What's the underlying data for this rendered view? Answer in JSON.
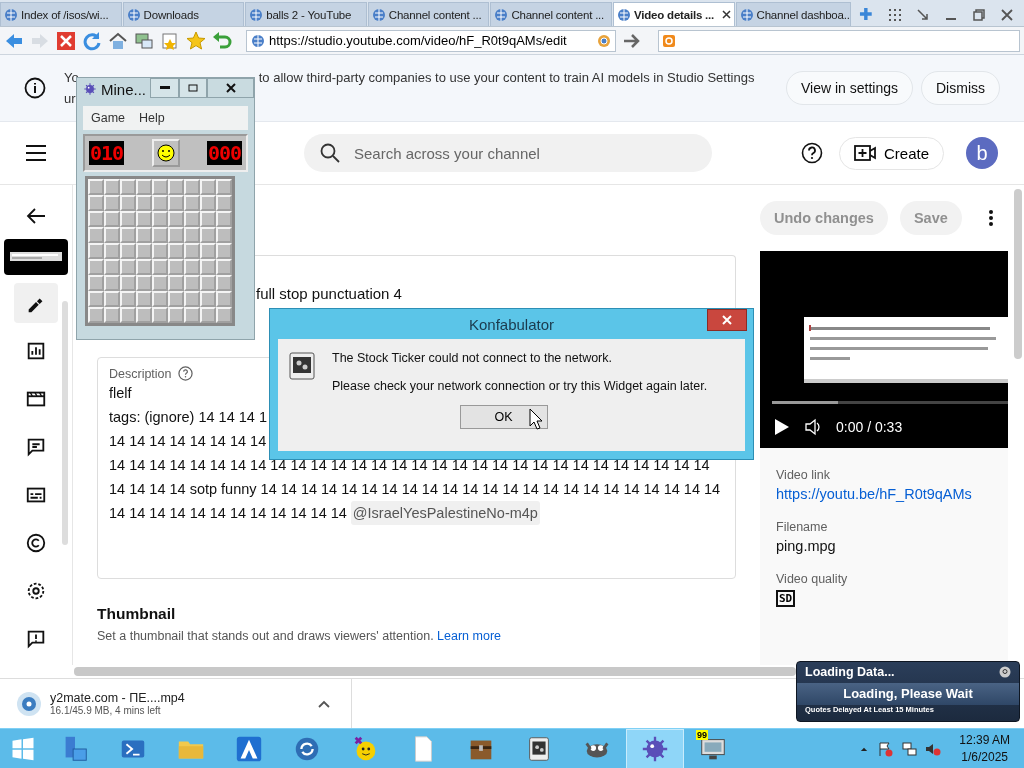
{
  "browser": {
    "tabs": [
      {
        "title": "Index of /isos/wi...",
        "selected": false
      },
      {
        "title": "Downloads",
        "selected": false
      },
      {
        "title": "balls 2 - YouTube",
        "selected": false
      },
      {
        "title": "Channel content ...",
        "selected": false
      },
      {
        "title": "Channel content ...",
        "selected": false
      },
      {
        "title": "Video details ...",
        "selected": true
      },
      {
        "title": "Channel dashboa...",
        "selected": false
      }
    ],
    "url": "https://studio.youtube.com/video/hF_R0t9qAMs/edit"
  },
  "banner": {
    "text_parts": [
      "Yo",
      "to allow third-party companies to use your content to train AI models in Studio Settings",
      "ur"
    ],
    "buttons": [
      "View in settings",
      "Dismiss"
    ]
  },
  "header": {
    "search_placeholder": "Search across your channel",
    "create": "Create",
    "avatar": "b"
  },
  "sidebar": {
    "items": [
      {
        "selected": true
      },
      {
        "selected": false
      },
      {
        "selected": false
      },
      {
        "selected": false
      },
      {
        "selected": false
      },
      {
        "selected": false
      },
      {
        "selected": false
      },
      {
        "selected": false
      }
    ]
  },
  "editor": {
    "title_value": "full stop punctuation 4",
    "description": {
      "label": "Description",
      "lines": [
        "flelf",
        "tags: (ignore) 14 14 14 1",
        "14 14 14 14 14 14 14 14",
        "14 14 14 14 14 14 14 14 14 14 14 14 14 14 14 14 14 14 14 14 14 14 14 14 14 14 14 14 14 14",
        "14 14 14 14  sotp funny 14 14 14 14 14 14 14 14 14 14 14 14 14 14 14 14 14 14 14 14 14 14 14",
        "14 14 14 14 14 14 14 14 14 14 14 14"
      ],
      "mention": "@IsraelYesPalestineNo-m4p"
    },
    "thumbnail": {
      "heading": "Thumbnail",
      "text": "Set a thumbnail that stands out and draws viewers' attention.",
      "link": "Learn more"
    }
  },
  "actions": {
    "undo": "Undo changes",
    "save": "Save"
  },
  "player": {
    "time": "0:00 / 0:33",
    "level": 0.28
  },
  "details": [
    {
      "label": "Video link",
      "value": "https://youtu.be/hF_R0t9qAMs",
      "kind": "link"
    },
    {
      "label": "Filename",
      "value": "ping.mpg",
      "kind": "text"
    },
    {
      "label": "Video quality",
      "value": "SD",
      "kind": "badge"
    }
  ],
  "download": {
    "filename": "y2mate.com - ПЕ....mp4",
    "progress": "16.1/45.9 MB, 4 mins left"
  },
  "taskbar": {
    "apps": [
      {
        "active": false
      },
      {
        "active": false
      },
      {
        "active": false
      },
      {
        "active": false
      },
      {
        "active": false
      },
      {
        "active": false
      },
      {
        "active": false
      },
      {
        "active": false
      },
      {
        "active": false
      },
      {
        "active": false
      },
      {
        "active": true
      },
      {
        "active": false
      }
    ],
    "badge": "99",
    "time": "12:39 AM",
    "date": "1/6/2025"
  },
  "minesweeper": {
    "title": "Mine...",
    "menu": [
      "Game",
      "Help"
    ],
    "mines": "010",
    "timer": "000"
  },
  "dialog": {
    "title": "Konfabulator",
    "lines": [
      "The Stock Ticker could not connect to the network.",
      "Please check your network connection or try this Widget again later."
    ],
    "button": "OK"
  },
  "widget": {
    "title": "Loading Data...",
    "status": "Loading, Please Wait",
    "note": "Quotes Delayed At Least 15 Minutes"
  }
}
